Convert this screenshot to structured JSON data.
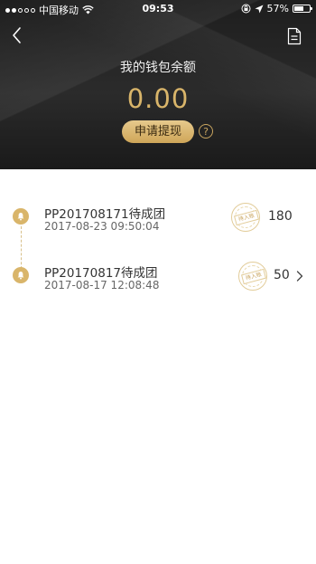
{
  "status_bar": {
    "carrier": "中国移动",
    "time": "09:53",
    "battery": "57%",
    "battery_level": 0.57
  },
  "header": {
    "icons": {
      "back": "back-chevron-icon",
      "document": "document-icon"
    },
    "balance_label": "我的钱包余额",
    "balance_amount": "0.00",
    "withdraw_label": "申请提现",
    "help_label": "?",
    "colors": {
      "gold": "#d9b56a",
      "background": "#242424"
    }
  },
  "records": [
    {
      "title": "PP201708171待成团",
      "time": "2017-08-23 09:50:04",
      "stamp_text": "待入账",
      "amount": "180"
    },
    {
      "title": "PP20170817待成团",
      "time": "2017-08-17 12:08:48",
      "stamp_text": "待入账",
      "amount": "50"
    }
  ]
}
